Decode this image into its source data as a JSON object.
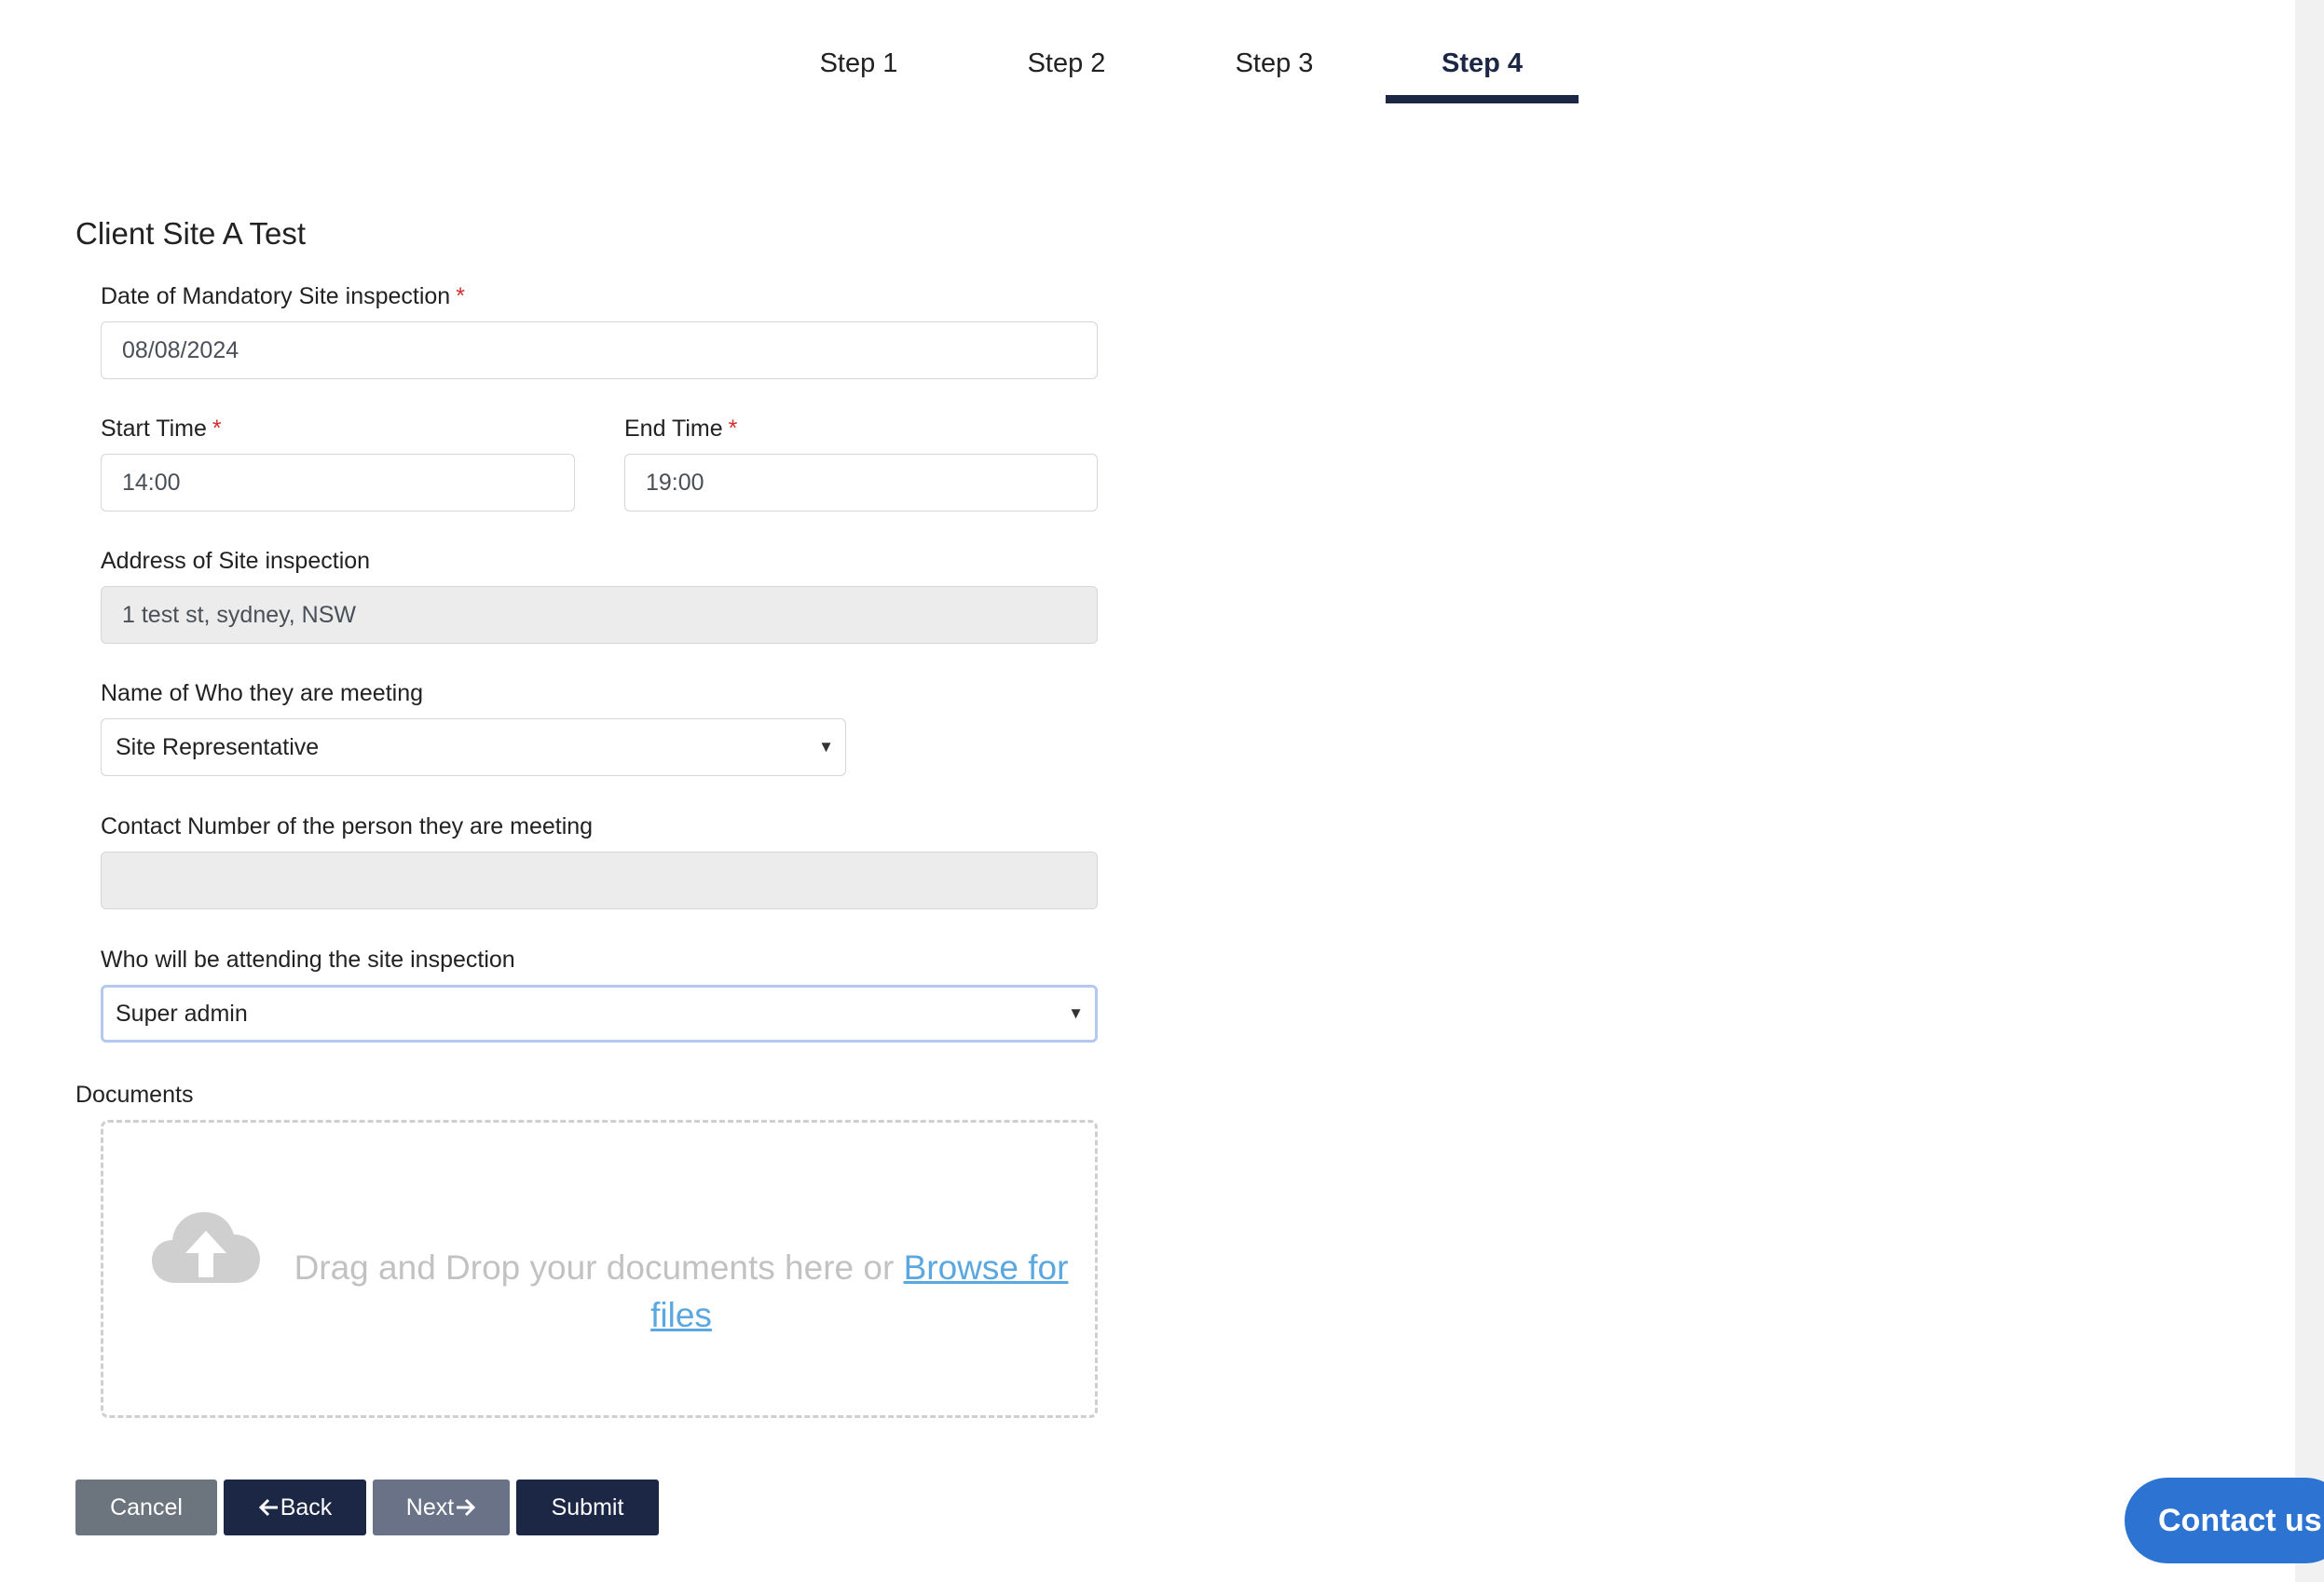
{
  "steps": [
    {
      "label": "Step 1"
    },
    {
      "label": "Step 2"
    },
    {
      "label": "Step 3"
    },
    {
      "label": "Step 4",
      "active": true
    }
  ],
  "section_title": "Client Site A Test",
  "form": {
    "date": {
      "label": "Date of Mandatory Site inspection",
      "required": "*",
      "value": "08/08/2024"
    },
    "start_time": {
      "label": "Start Time",
      "required": "*",
      "value": "14:00"
    },
    "end_time": {
      "label": "End Time",
      "required": "*",
      "value": "19:00"
    },
    "address": {
      "label": "Address of Site inspection",
      "value": "1 test st, sydney, NSW"
    },
    "meeting_name": {
      "label": "Name of Who they are meeting",
      "value": "Site Representative"
    },
    "contact_number": {
      "label": "Contact Number of the person they are meeting",
      "value": ""
    },
    "attendee": {
      "label": "Who will be attending the site inspection",
      "value": "Super admin"
    }
  },
  "documents": {
    "label": "Documents",
    "drop_text": "Drag and Drop your documents here or ",
    "browse_text": "Browse for files",
    "icon": "cloud-upload-icon"
  },
  "buttons": {
    "cancel": "Cancel",
    "back": "Back",
    "next": "Next",
    "submit": "Submit"
  },
  "contact_us": "Contact us",
  "colors": {
    "primary": "#1b2744",
    "secondary": "#6c757d",
    "link": "#5ba7e0",
    "required": "#d32f2f",
    "contact_button": "#2c73d2"
  }
}
